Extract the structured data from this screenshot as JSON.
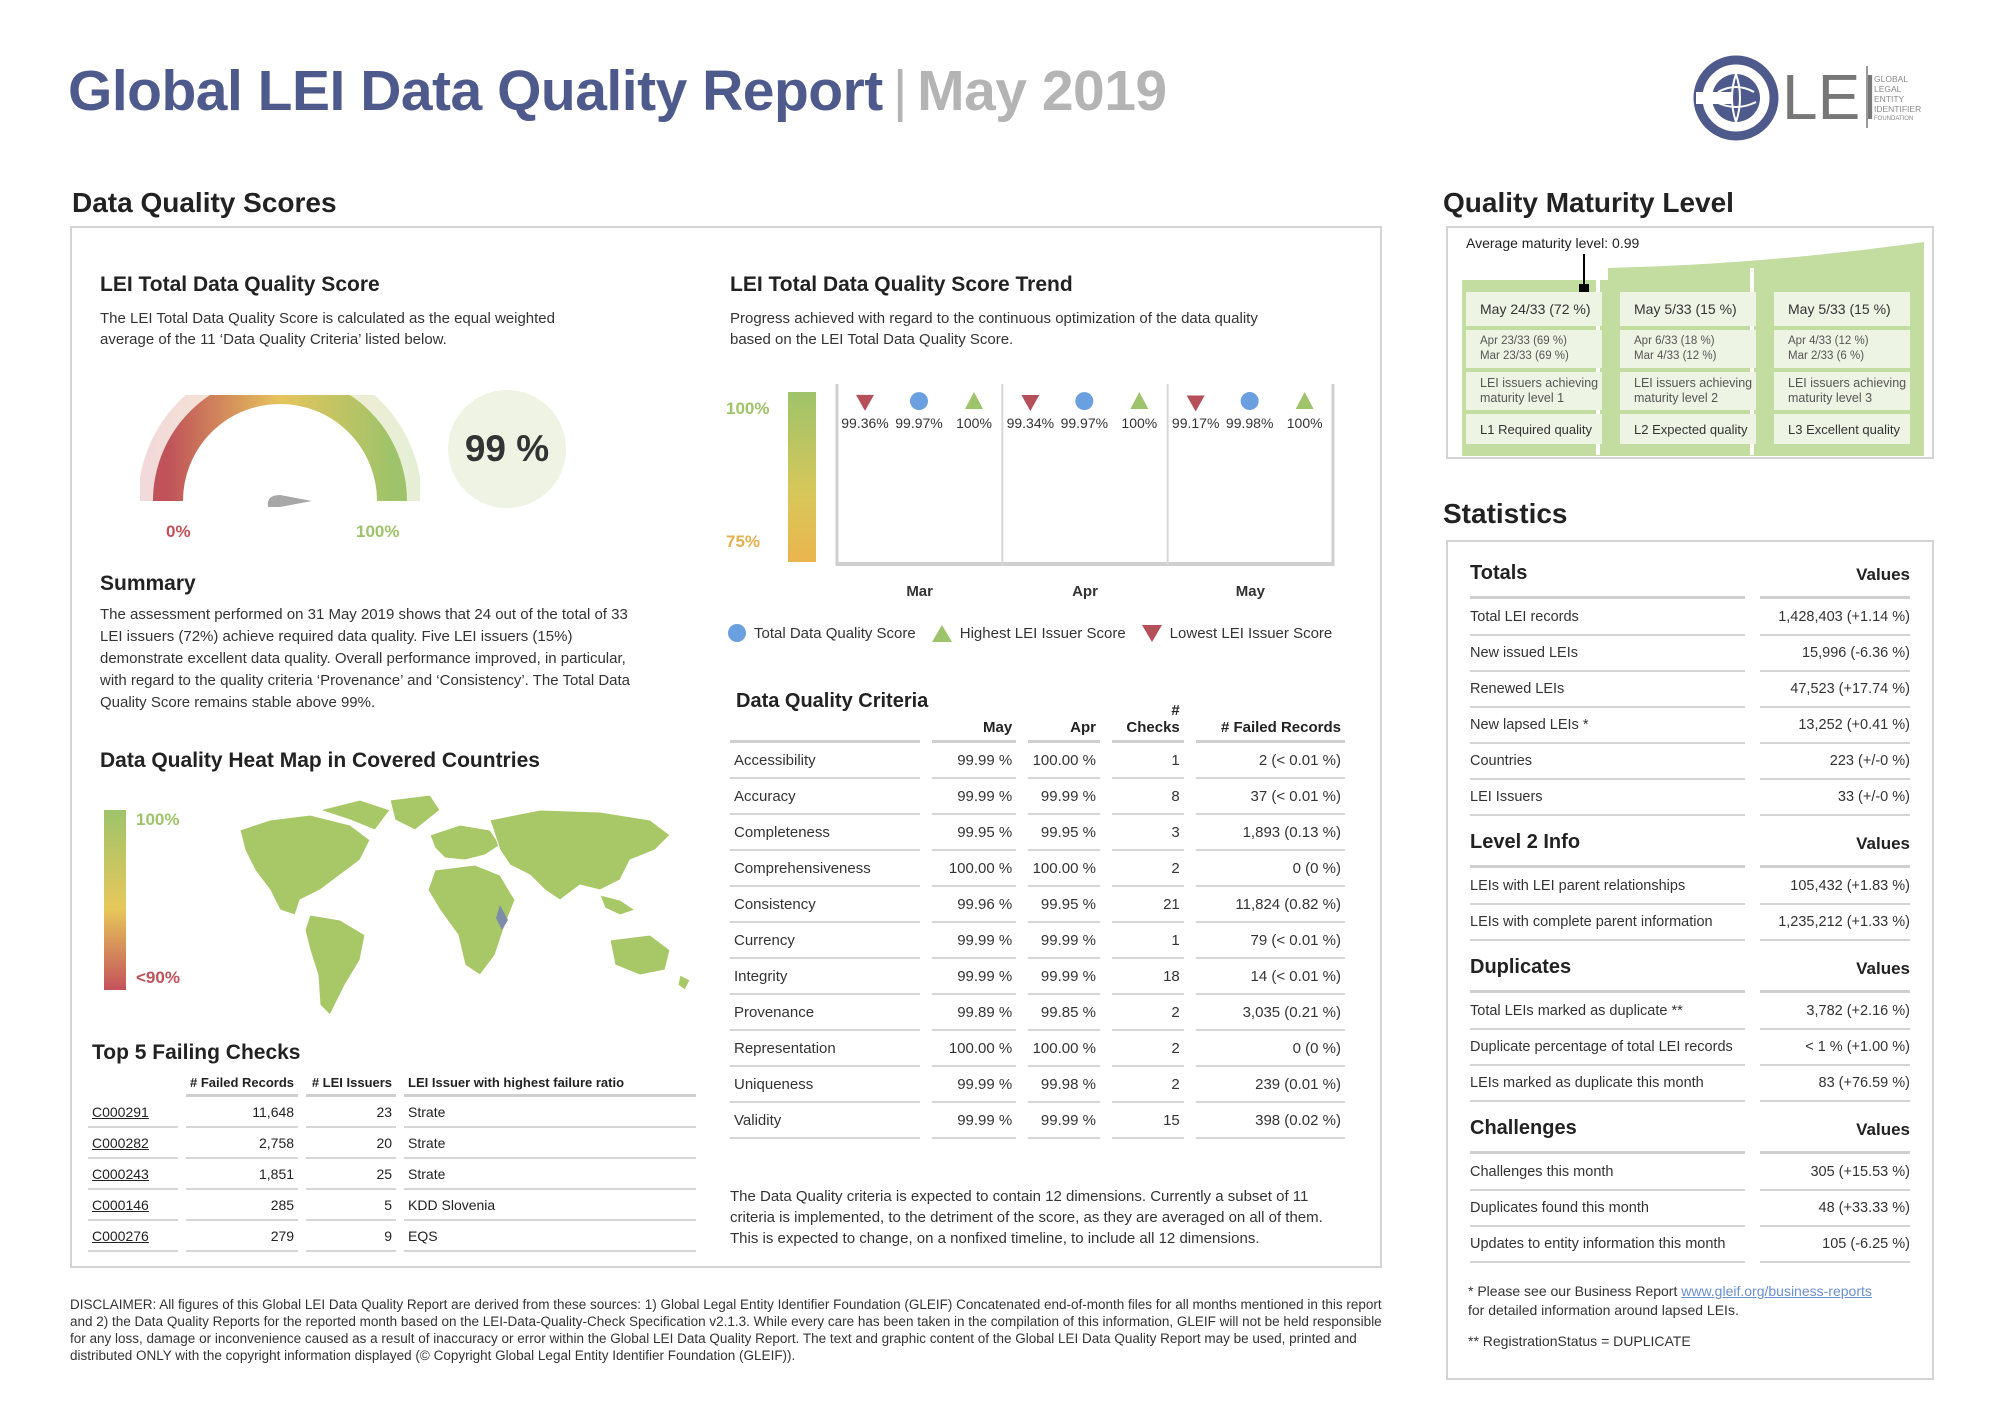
{
  "header": {
    "title": "Global LEI Data Quality Report",
    "separator": "|",
    "month": "May 2019",
    "logo_text": "LEI",
    "logo_org": [
      "GLOBAL",
      "LEGAL",
      "ENTITY",
      "IDENTIFIER",
      "FOUNDATION"
    ]
  },
  "scores": {
    "heading": "Data Quality Scores",
    "total": {
      "title": "LEI Total Data Quality Score",
      "description": "The LEI Total Data Quality Score is calculated as the equal weighted average of the 11 ‘Data Quality Criteria’ listed below.",
      "score": "99 %",
      "score_value": 99,
      "min_label": "0%",
      "max_label": "100%"
    },
    "summary": {
      "title": "Summary",
      "text": "The assessment performed on 31 May 2019 shows that 24 out of the total of 33 LEI issuers (72%) achieve required data quality. Five LEI issuers (15%) demonstrate excellent data quality. Overall performance improved, in particular, with regard to the quality criteria ‘Provenance’ and ‘Consistency’. The Total Data Quality Score remains stable above 99%."
    },
    "heatmap": {
      "title": "Data Quality Heat Map in Covered Countries",
      "top_label": "100%",
      "bottom_label": "<90%"
    },
    "failing": {
      "title": "Top 5 Failing Checks",
      "columns": [
        "# Failed Records",
        "# LEI Issuers",
        "LEI Issuer with highest failure ratio"
      ],
      "rows": [
        {
          "check": "C000291",
          "failed": "11,648",
          "issuers": "23",
          "issuer": "Strate"
        },
        {
          "check": "C000282",
          "failed": "2,758",
          "issuers": "20",
          "issuer": "Strate"
        },
        {
          "check": "C000243",
          "failed": "1,851",
          "issuers": "25",
          "issuer": "Strate"
        },
        {
          "check": "C000146",
          "failed": "285",
          "issuers": "5",
          "issuer": "KDD Slovenia"
        },
        {
          "check": "C000276",
          "failed": "279",
          "issuers": "9",
          "issuer": "EQS"
        }
      ]
    },
    "trend": {
      "title": "LEI Total Data Quality Score Trend",
      "description": "Progress achieved with regard to the continuous optimization of the data quality based on the LEI Total Data Quality Score.",
      "axis_top": "100%",
      "axis_bottom": "75%",
      "legend": [
        "Total Data Quality Score",
        "Highest LEI Issuer Score",
        "Lowest LEI Issuer Score"
      ],
      "colors": {
        "total": "#6a9fe0",
        "highest": "#9ec36a",
        "lowest": "#b5505a"
      }
    },
    "criteria": {
      "title": "Data Quality Criteria",
      "columns": [
        "May",
        "Apr",
        "# Checks",
        "# Failed Records"
      ],
      "rows": [
        {
          "name": "Accessibility",
          "may": "99.99 %",
          "apr": "100.00 %",
          "checks": "1",
          "failed": "2 (< 0.01 %)"
        },
        {
          "name": "Accuracy",
          "may": "99.99 %",
          "apr": "99.99 %",
          "checks": "8",
          "failed": "37 (< 0.01 %)"
        },
        {
          "name": "Completeness",
          "may": "99.95 %",
          "apr": "99.95 %",
          "checks": "3",
          "failed": "1,893 (0.13 %)"
        },
        {
          "name": "Comprehensiveness",
          "may": "100.00 %",
          "apr": "100.00 %",
          "checks": "2",
          "failed": "0 (0 %)"
        },
        {
          "name": "Consistency",
          "may": "99.96 %",
          "apr": "99.95 %",
          "checks": "21",
          "failed": "11,824 (0.82 %)"
        },
        {
          "name": "Currency",
          "may": "99.99 %",
          "apr": "99.99 %",
          "checks": "1",
          "failed": "79 (< 0.01 %)"
        },
        {
          "name": "Integrity",
          "may": "99.99 %",
          "apr": "99.99 %",
          "checks": "18",
          "failed": "14 (< 0.01 %)"
        },
        {
          "name": "Provenance",
          "may": "99.89 %",
          "apr": "99.85 %",
          "checks": "2",
          "failed": "3,035 (0.21 %)"
        },
        {
          "name": "Representation",
          "may": "100.00 %",
          "apr": "100.00 %",
          "checks": "2",
          "failed": "0 (0 %)"
        },
        {
          "name": "Uniqueness",
          "may": "99.99 %",
          "apr": "99.98 %",
          "checks": "2",
          "failed": "239 (0.01 %)"
        },
        {
          "name": "Validity",
          "may": "99.99 %",
          "apr": "99.99 %",
          "checks": "15",
          "failed": "398 (0.02 %)"
        }
      ],
      "note": "The Data Quality criteria is expected to contain 12 dimensions. Currently a subset of 11 criteria is implemented, to the detriment of the score, as they are averaged on all of them. This is expected to change, on a nonfixed timeline, to include all 12 dimensions."
    }
  },
  "chart_data": {
    "type": "scatter",
    "title": "LEI Total Data Quality Score Trend",
    "categories": [
      "Mar",
      "Apr",
      "May"
    ],
    "ylim": [
      75,
      100
    ],
    "series": [
      {
        "name": "Lowest LEI Issuer Score",
        "values": [
          99.36,
          99.34,
          99.17
        ],
        "labels": [
          "99.36%",
          "99.34%",
          "99.17%"
        ]
      },
      {
        "name": "Total Data Quality Score",
        "values": [
          99.97,
          99.97,
          99.98
        ],
        "labels": [
          "99.97%",
          "99.97%",
          "99.98%"
        ]
      },
      {
        "name": "Highest LEI Issuer Score",
        "values": [
          100,
          100,
          100
        ],
        "labels": [
          "100%",
          "100%",
          "100%"
        ]
      }
    ]
  },
  "maturity": {
    "heading": "Quality Maturity Level",
    "average": "Average maturity level: 0.99",
    "levels": [
      {
        "current": "May 24/33 (72 %)",
        "prev1": "Apr 23/33 (69 %)",
        "prev2": "Mar 23/33 (69 %)",
        "desc1": "LEI issuers achieving",
        "desc2": "maturity level 1",
        "name": "L1 Required quality"
      },
      {
        "current": "May 5/33 (15 %)",
        "prev1": "Apr 6/33 (18 %)",
        "prev2": "Mar 4/33 (12 %)",
        "desc1": "LEI issuers achieving",
        "desc2": "maturity level 2",
        "name": "L2 Expected quality"
      },
      {
        "current": "May 5/33 (15 %)",
        "prev1": "Apr 4/33 (12 %)",
        "prev2": "Mar 2/33 (6 %)",
        "desc1": "LEI issuers achieving",
        "desc2": "maturity level 3",
        "name": "L3 Excellent quality"
      }
    ]
  },
  "statistics": {
    "heading": "Statistics",
    "values_label": "Values",
    "groups": [
      {
        "title": "Totals",
        "rows": [
          {
            "label": "Total LEI records",
            "value": "1,428,403 (+1.14 %)"
          },
          {
            "label": "New issued LEIs",
            "value": "15,996 (-6.36 %)"
          },
          {
            "label": "Renewed LEIs",
            "value": "47,523 (+17.74 %)"
          },
          {
            "label": "New lapsed LEIs *",
            "value": "13,252 (+0.41 %)"
          },
          {
            "label": "Countries",
            "value": "223 (+/-0 %)"
          },
          {
            "label": "LEI Issuers",
            "value": "33 (+/-0 %)"
          }
        ]
      },
      {
        "title": "Level 2 Info",
        "rows": [
          {
            "label": "LEIs with LEI parent relationships",
            "value": "105,432 (+1.83 %)"
          },
          {
            "label": "LEIs with complete parent information",
            "value": "1,235,212 (+1.33 %)"
          }
        ]
      },
      {
        "title": "Duplicates",
        "rows": [
          {
            "label": "Total LEIs marked as duplicate **",
            "value": "3,782 (+2.16 %)"
          },
          {
            "label": "Duplicate percentage of total LEI records",
            "value": "< 1 % (+1.00 %)"
          },
          {
            "label": "LEIs marked as duplicate this month",
            "value": "83 (+76.59 %)"
          }
        ]
      },
      {
        "title": "Challenges",
        "rows": [
          {
            "label": "Challenges this month",
            "value": "305 (+15.53 %)"
          },
          {
            "label": "Duplicates found this month",
            "value": "48 (+33.33 %)"
          },
          {
            "label": "Updates to entity information this month",
            "value": "105 (-6.25 %)"
          }
        ]
      }
    ],
    "note1_prefix": "* Please see our Business Report ",
    "note1_link": "www.gleif.org/business-reports",
    "note1_suffix": "for detailed information around lapsed LEIs.",
    "note2": "** RegistrationStatus = DUPLICATE"
  },
  "disclaimer": "DISCLAIMER: All figures of this Global LEI Data Quality Report are derived from these sources: 1) Global Legal Entity Identifier Foundation (GLEIF) Concatenated end-of-month files for all months mentioned in this report and 2) the Data Quality Reports for the reported month based on the LEI-Data-Quality-Check Specification v2.1.3. While every care has been taken in the compilation of this information, GLEIF will not be held responsible for any loss, damage or inconvenience caused as a result of inaccuracy or error within the Global LEI Data Quality Report. The text and graphic content of the Global LEI Data Quality Report may be used, printed and distributed ONLY with the copyright information displayed (© Copyright Global Legal Entity Identifier Foundation (GLEIF))."
}
